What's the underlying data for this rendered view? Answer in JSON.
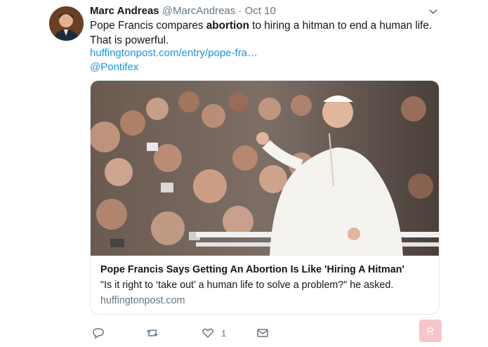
{
  "author": {
    "name": "Marc Andreas",
    "handle": "@MarcAndreas",
    "separator": "·",
    "date": "Oct 10"
  },
  "tweet": {
    "text_before": "Pope Francis compares ",
    "text_bold": "abortion",
    "text_after": " to hiring a hitman to end a human life. That is powerful.",
    "link": "huffingtonpost.com/entry/pope-fra…",
    "mention": "@Pontifex"
  },
  "card": {
    "title": "Pope Francis Says Getting An Abortion Is Like 'Hiring A Hitman'",
    "description": "\"Is it right to ‘take out’ a human life to solve a problem?\" he asked.",
    "domain": "huffingtonpost.com"
  },
  "actions": {
    "reply_icon": "reply-icon",
    "retweet_icon": "retweet-icon",
    "like_icon": "heart-icon",
    "like_count": "1",
    "dm_icon": "envelope-icon"
  },
  "overlay_button": {
    "label": "R"
  },
  "colors": {
    "link": "#1b95e0",
    "muted": "#657786",
    "text": "#14171a",
    "border": "#e1e8ed",
    "overlay_button": "#f7c6cc"
  }
}
